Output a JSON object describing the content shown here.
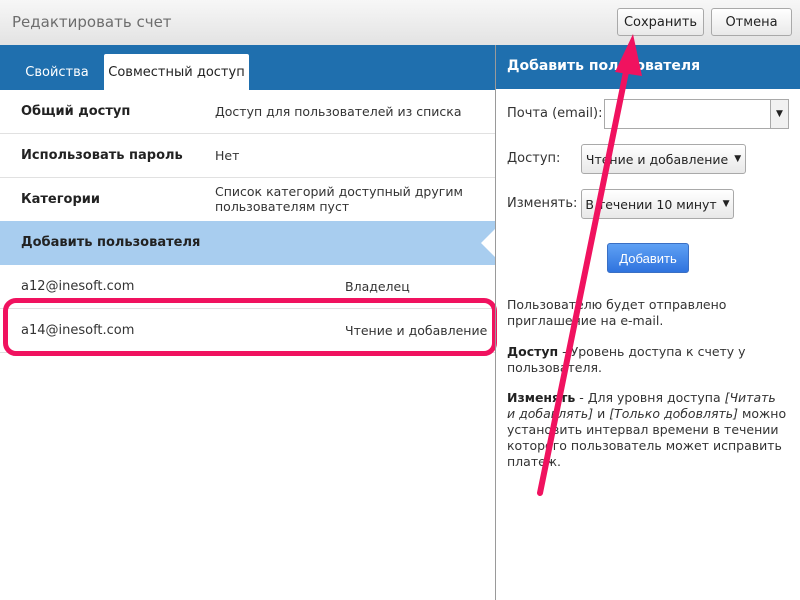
{
  "window": {
    "title": "Редактировать счет"
  },
  "toolbar": {
    "save_label": "Сохранить",
    "cancel_label": "Отмена"
  },
  "tabs": [
    {
      "label": "Свойства",
      "active": false
    },
    {
      "label": "Совместный доступ",
      "active": true
    }
  ],
  "properties": [
    {
      "key": "Общий доступ",
      "value": "Доступ для пользователей из списка"
    },
    {
      "key": "Использовать пароль",
      "value": "Нет"
    },
    {
      "key": "Категории",
      "value": "Список категорий доступный другим пользователям пуст"
    }
  ],
  "add_user_row": {
    "label": "Добавить пользователя"
  },
  "users": [
    {
      "email": "a12@inesoft.com",
      "role": "Владелец"
    },
    {
      "email": "a14@inesoft.com",
      "role": "Чтение и добавление"
    }
  ],
  "right_panel": {
    "title": "Добавить пользователя",
    "email_label": "Почта (email):",
    "email_value": "",
    "access_label": "Доступ:",
    "access_value": "Чтение и добавление",
    "change_label": "Изменять:",
    "change_value": "В течении 10 минут",
    "add_button": "Добавить",
    "info": {
      "p1": "Пользователю будет отправлено приглашение на e-mail.",
      "p2_bold": "Доступ",
      "p2_text": " - Уровень доступа к счету у пользователя.",
      "p3_bold": "Изменять",
      "p3_text1": " - Для уровня доступа ",
      "p3_italic": "[Читать и добавлять]",
      "p3_text2": " и ",
      "p3_italic2": "[Только добовлять]",
      "p3_text3": " можно установить интервал времени в течении которого пользователь может исправить платеж."
    }
  },
  "annotation": {
    "highlight_color": "#f0125f",
    "arrow_color": "#f0125f"
  }
}
